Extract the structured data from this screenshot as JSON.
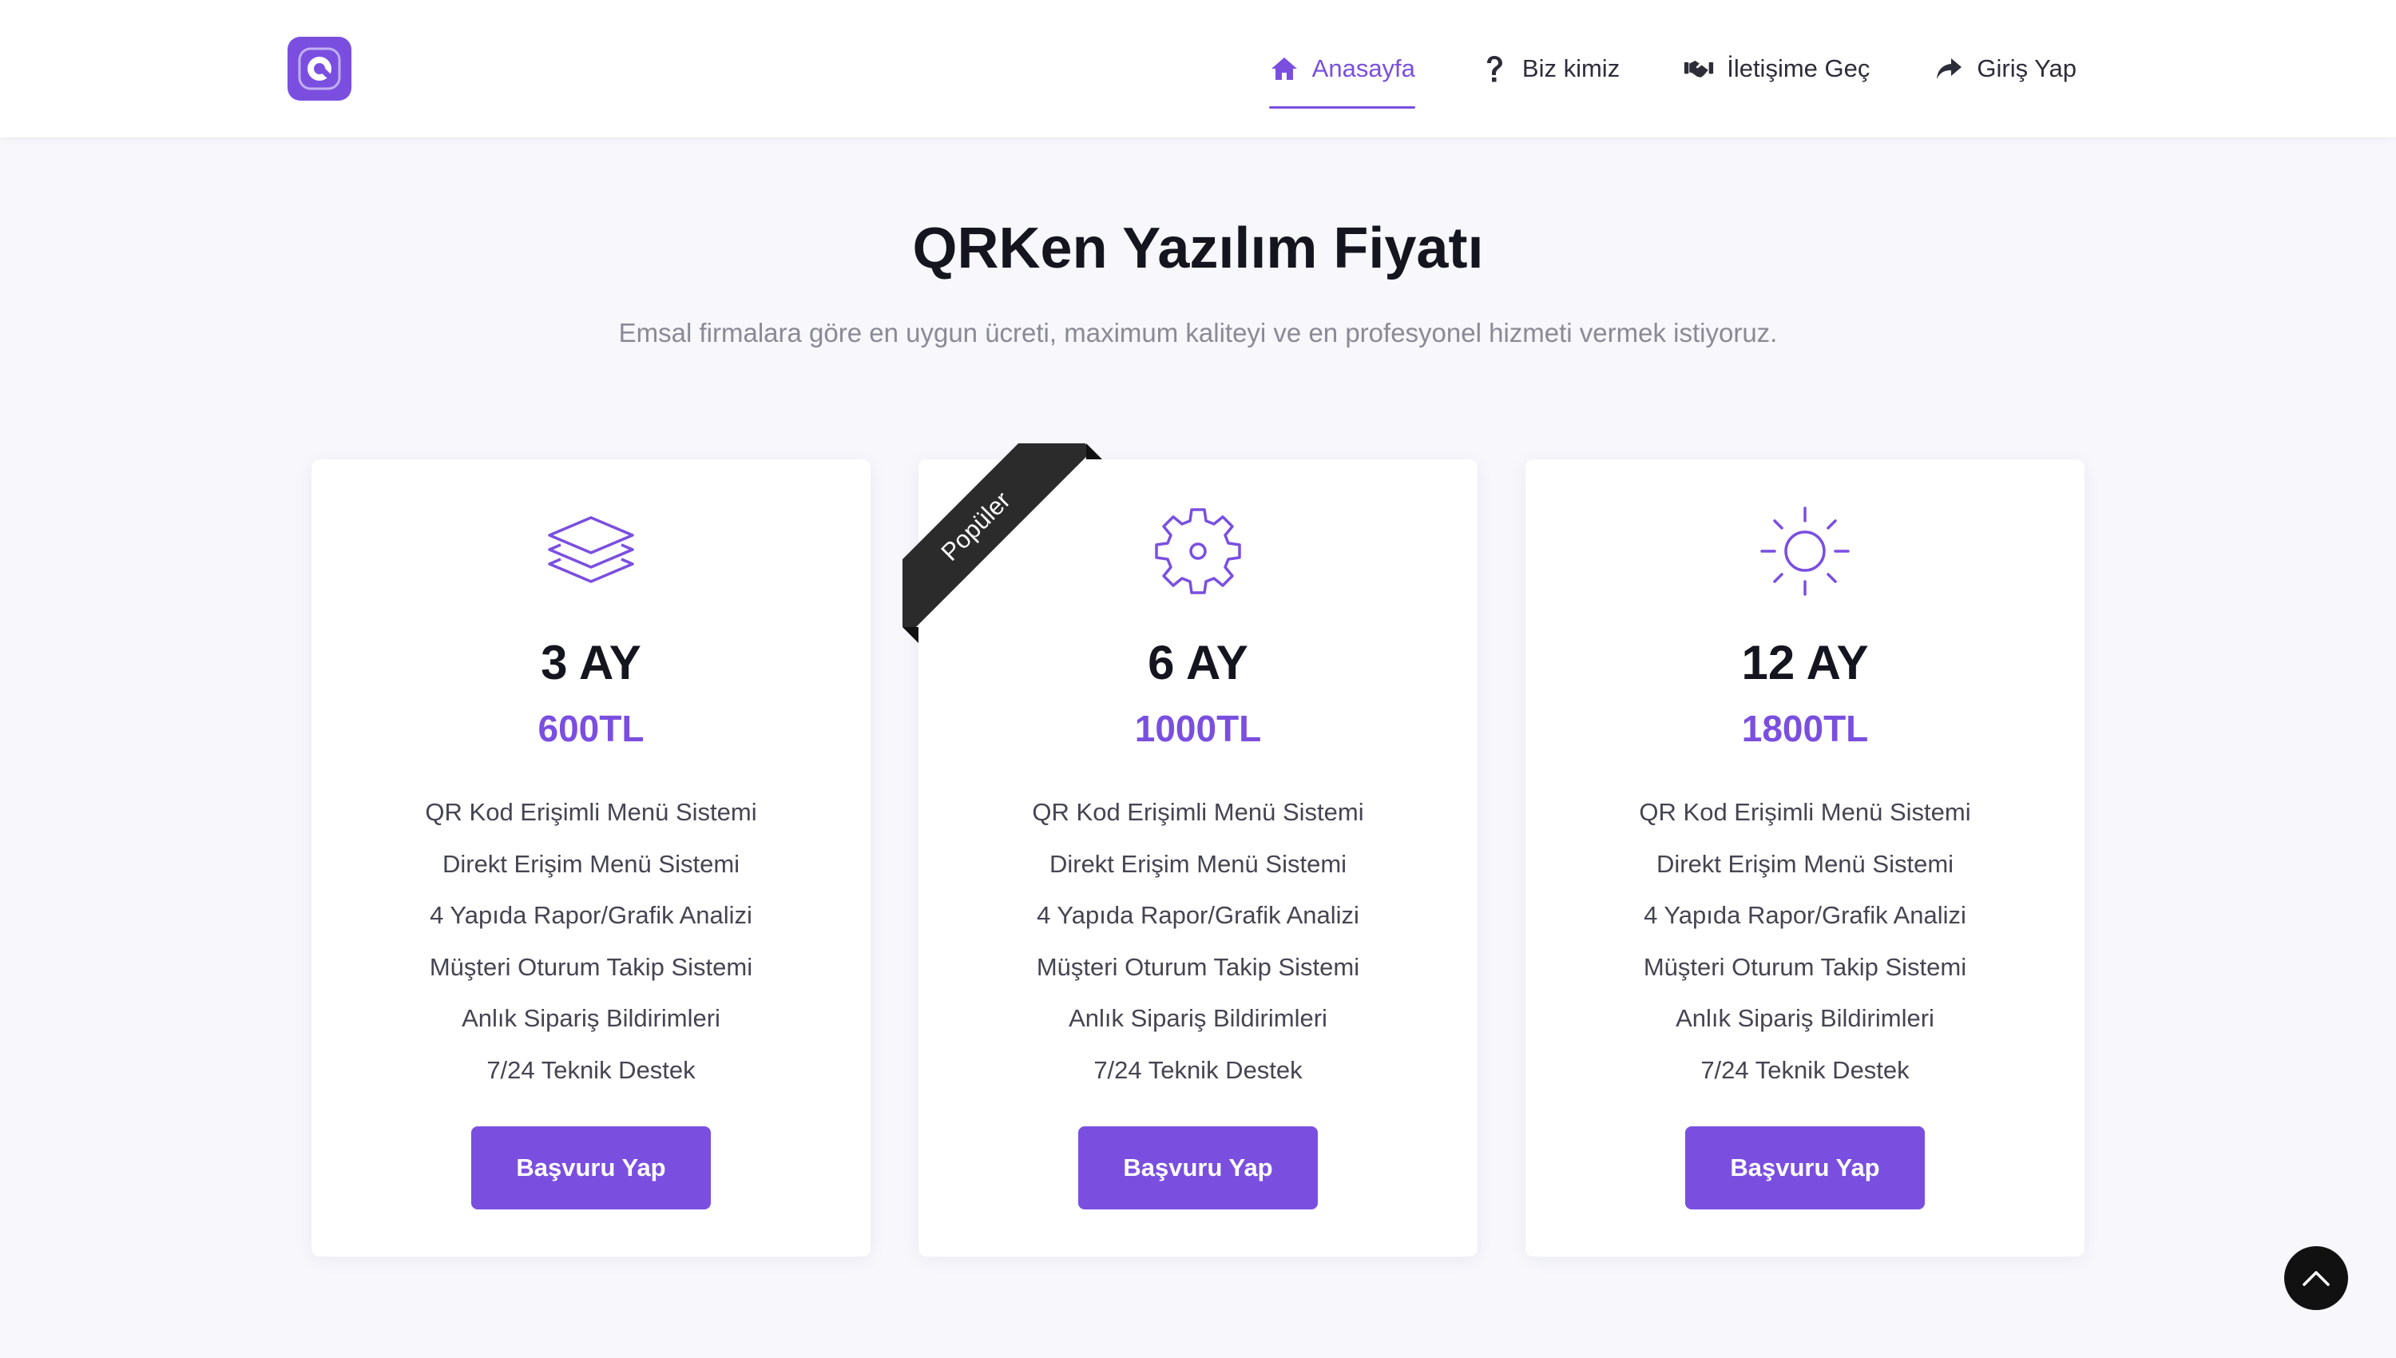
{
  "brand": {
    "logo_icon": "q-logo-icon",
    "accent": "#7a4fe0"
  },
  "nav": {
    "items": [
      {
        "label": "Anasayfa",
        "icon": "home-icon",
        "active": true
      },
      {
        "label": "Biz kimiz",
        "icon": "question-icon",
        "active": false
      },
      {
        "label": "İletişime Geç",
        "icon": "handshake-icon",
        "active": false
      },
      {
        "label": "Giriş Yap",
        "icon": "share-arrow-icon",
        "active": false
      }
    ]
  },
  "section": {
    "title": "QRKen Yazılım Fiyatı",
    "subtitle": "Emsal firmalara göre en uygun ücreti, maximum kaliteyi ve en profesyonel hizmeti vermek istiyoruz."
  },
  "plans": [
    {
      "icon": "layers-icon",
      "name": "3 AY",
      "price": "600TL",
      "features": [
        "QR Kod Erişimli Menü Sistemi",
        "Direkt Erişim Menü Sistemi",
        "4 Yapıda Rapor/Grafik Analizi",
        "Müşteri Oturum Takip Sistemi",
        "Anlık Sipariş Bildirimleri",
        "7/24 Teknik Destek"
      ],
      "button_label": "Başvuru Yap"
    },
    {
      "icon": "gear-icon",
      "name": "6 AY",
      "price": "1000TL",
      "ribbon": "Popüler",
      "features": [
        "QR Kod Erişimli Menü Sistemi",
        "Direkt Erişim Menü Sistemi",
        "4 Yapıda Rapor/Grafik Analizi",
        "Müşteri Oturum Takip Sistemi",
        "Anlık Sipariş Bildirimleri",
        "7/24 Teknik Destek"
      ],
      "button_label": "Başvuru Yap"
    },
    {
      "icon": "sun-icon",
      "name": "12 AY",
      "price": "1800TL",
      "features": [
        "QR Kod Erişimli Menü Sistemi",
        "Direkt Erişim Menü Sistemi",
        "4 Yapıda Rapor/Grafik Analizi",
        "Müşteri Oturum Takip Sistemi",
        "Anlık Sipariş Bildirimleri",
        "7/24 Teknik Destek"
      ],
      "button_label": "Başvuru Yap"
    }
  ],
  "scroll_top": {
    "icon": "chevron-up-icon"
  }
}
